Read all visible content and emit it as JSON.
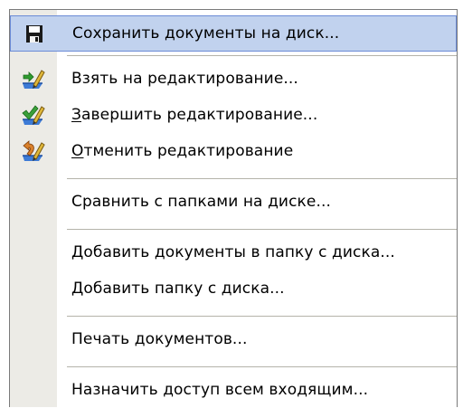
{
  "menu": {
    "items": [
      {
        "label": "Сохранить документы на диск...",
        "icon": "save-disk-icon"
      },
      {
        "label": "Взять на редактирование...",
        "icon": "check-out-edit-icon"
      },
      {
        "label_access": "З",
        "label_rest": "авершить  редактирование...",
        "icon": "check-in-edit-icon"
      },
      {
        "label_access": "О",
        "label_rest": "тменить редактирование",
        "icon": "undo-edit-icon"
      },
      {
        "label": "Сравнить с папками на диске..."
      },
      {
        "label": "Добавить документы в папку с диска..."
      },
      {
        "label": "Добавить папку с диска..."
      },
      {
        "label": "Печать документов..."
      },
      {
        "label": "Назначить доступ всем входящим..."
      }
    ]
  },
  "colors": {
    "menu_background": "#ffffff",
    "icon_column": "#ecebe6",
    "highlight_fill": "#c1d2ee",
    "highlight_border": "#6b8bd6",
    "separator": "#b5b3aa"
  }
}
